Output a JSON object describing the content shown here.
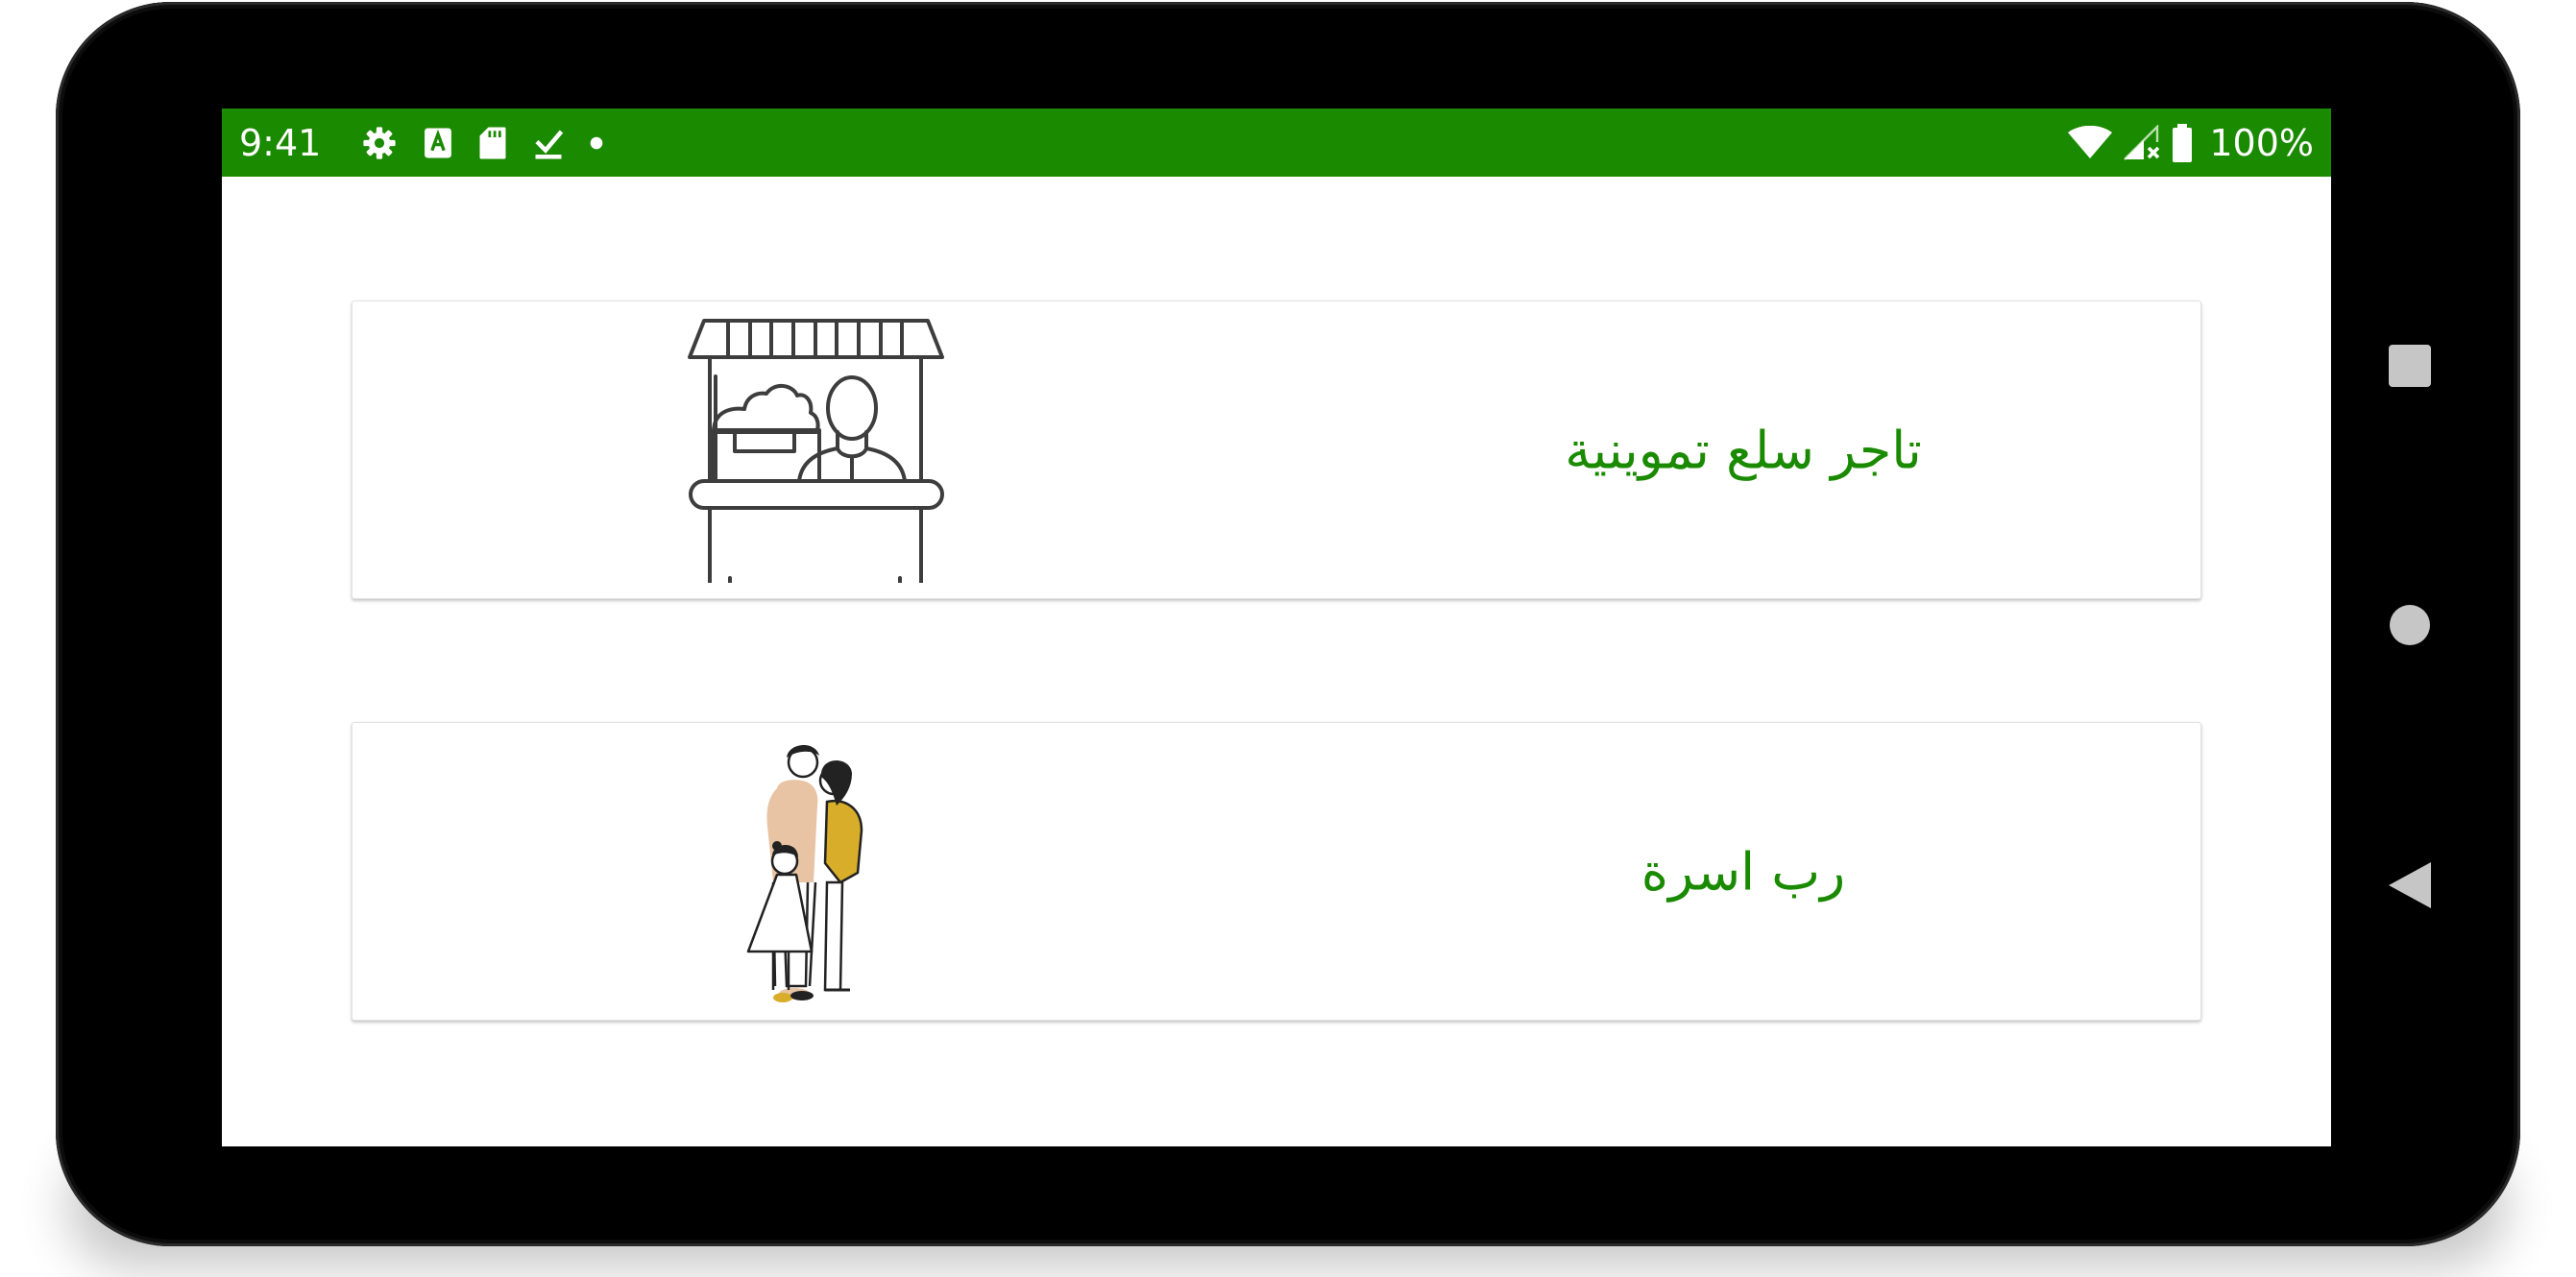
{
  "status_bar": {
    "time": "9:41",
    "left_icons": [
      "gear-icon",
      "text-a-icon",
      "sd-card-icon",
      "download-done-icon",
      "dot-icon"
    ],
    "right_icons": [
      "wifi-icon",
      "cell-signal-icon",
      "battery-icon"
    ],
    "battery": "100%"
  },
  "cards": [
    {
      "label": "تاجر سلع تموينية",
      "icon": "market-stall-vendor-icon"
    },
    {
      "label": "رب اسرة",
      "icon": "family-illustration"
    }
  ],
  "navigation_bar": {
    "buttons": [
      "recents-button",
      "home-button",
      "back-button"
    ]
  },
  "colors": {
    "accent": "#1a8a00",
    "label_text": "#1a8a00",
    "device_frame": "#000000",
    "icon_stroke": "#3d3d3d",
    "nav_buttons": "#c6c6c6",
    "family_mustard": "#d8ad2a",
    "family_skin": "#e8c4a4"
  }
}
